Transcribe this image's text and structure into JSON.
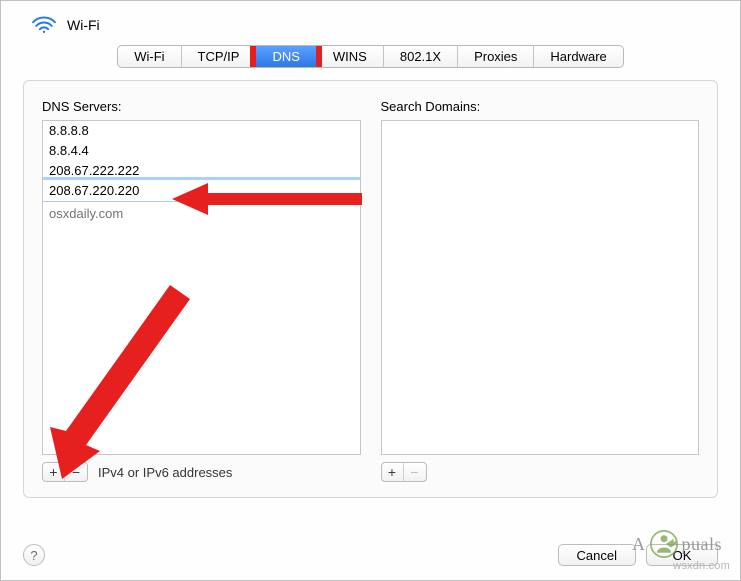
{
  "header": {
    "title": "Wi-Fi",
    "icon": "wifi-icon"
  },
  "tabs": [
    {
      "label": "Wi-Fi",
      "active": false
    },
    {
      "label": "TCP/IP",
      "active": false
    },
    {
      "label": "DNS",
      "active": true
    },
    {
      "label": "WINS",
      "active": false
    },
    {
      "label": "802.1X",
      "active": false
    },
    {
      "label": "Proxies",
      "active": false
    },
    {
      "label": "Hardware",
      "active": false
    }
  ],
  "dns": {
    "label": "DNS Servers:",
    "servers": [
      {
        "value": "8.8.8.8",
        "grey": false,
        "editing": false
      },
      {
        "value": "8.8.4.4",
        "grey": false,
        "editing": false
      },
      {
        "value": "208.67.222.222",
        "grey": false,
        "editing": false
      },
      {
        "value": "208.67.220.220",
        "grey": false,
        "editing": true
      },
      {
        "value": "osxdaily.com",
        "grey": true,
        "editing": false
      }
    ],
    "hint": "IPv4 or IPv6 addresses",
    "add_label": "+",
    "remove_label": "−",
    "remove_disabled": false
  },
  "search_domains": {
    "label": "Search Domains:",
    "items": [],
    "add_label": "+",
    "remove_label": "−",
    "remove_disabled": true
  },
  "footer": {
    "help_label": "?",
    "cancel_label": "Cancel",
    "ok_label": "OK"
  },
  "watermarks": {
    "site": "wsxdn.com",
    "brand_left": "A",
    "brand_right": "puals"
  },
  "colors": {
    "accent": "#2d78e6",
    "emphasis": "#e22021"
  }
}
